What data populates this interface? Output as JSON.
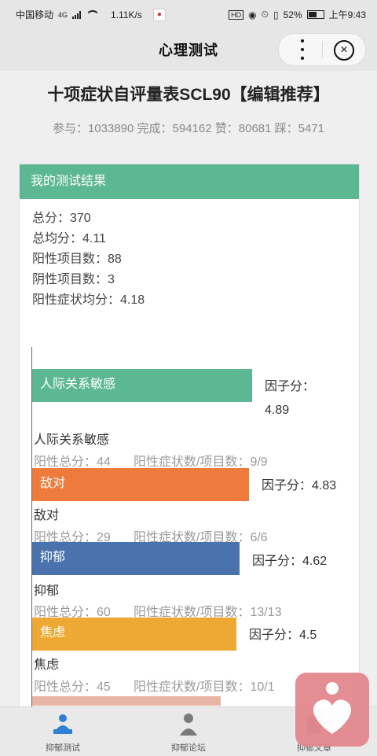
{
  "status": {
    "carrier": "中国移动",
    "net": "4G",
    "speed": "1.11K/s",
    "hd": "HD",
    "battery": "52%",
    "time": "上午9:43"
  },
  "nav": {
    "title": "心理测试"
  },
  "test": {
    "title": "十项症状自评量表SCL90【编辑推荐】",
    "stats": "参与：1033890 完成：594162 赞：80681 踩：5471"
  },
  "result": {
    "header": "我的测试结果",
    "total": "总分：370",
    "avg": "总均分：4.11",
    "positive_count": "阳性项目数：88",
    "negative_count": "阴性项目数：3",
    "positive_avg": "阳性症状均分：4.18"
  },
  "factors": [
    {
      "name": "人际关系敏感",
      "score_label": "因子分：",
      "score_value": "4.89",
      "score": 4.89,
      "color": "#5cb893",
      "positive_total": "阳性总分：44",
      "positive_ratio": "阳性症状数/项目数：9/9"
    },
    {
      "name": "敌对",
      "score_label": "因子分：",
      "score_value": "4.83",
      "score": 4.83,
      "color": "#ee7b3c",
      "positive_total": "阳性总分：29",
      "positive_ratio": "阳性症状数/项目数：6/6"
    },
    {
      "name": "抑郁",
      "score_label": "因子分：",
      "score_value": "4.62",
      "score": 4.62,
      "color": "#4a73ad",
      "positive_total": "阳性总分：60",
      "positive_ratio": "阳性症状数/项目数：13/13"
    },
    {
      "name": "焦虑",
      "score_label": "因子分：",
      "score_value": "4.5",
      "score": 4.5,
      "color": "#eea934",
      "positive_total": "阳性总分：45",
      "positive_ratio": "阳性症状数/项目数：10/1"
    }
  ],
  "tabs": [
    {
      "label": "抑郁测试",
      "icon": "person-desk-icon",
      "active": true
    },
    {
      "label": "抑郁论坛",
      "icon": "person-suit-icon",
      "active": false
    },
    {
      "label": "抑郁文章",
      "icon": "article-icon",
      "active": false
    }
  ]
}
